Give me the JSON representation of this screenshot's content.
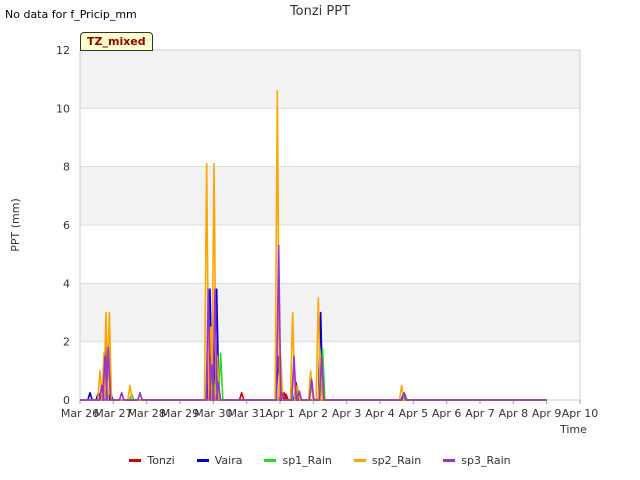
{
  "notice": "No data for f_Pricip_mm",
  "badge": "TZ_mixed",
  "colors": {
    "Tonzi": "#cc0000",
    "Vaira": "#0000cc",
    "sp1_Rain": "#22dd22",
    "sp2_Rain": "#ffa500",
    "sp3_Rain": "#9933cc"
  },
  "chart_data": {
    "type": "line",
    "title": "Tonzi PPT",
    "xlabel": "Time",
    "ylabel": "PPT (mm)",
    "ylim": [
      0,
      12
    ],
    "xlim": [
      "Mar 26",
      "Apr 10"
    ],
    "yticks": [
      0,
      2,
      4,
      6,
      8,
      10,
      12
    ],
    "xticks": [
      "Mar 26",
      "Mar 27",
      "Mar 28",
      "Mar 29",
      "Mar 30",
      "Mar 31",
      "Apr 1",
      "Apr 2",
      "Apr 3",
      "Apr 4",
      "Apr 5",
      "Apr 6",
      "Apr 7",
      "Apr 8",
      "Apr 9",
      "Apr 10"
    ],
    "grid": true,
    "legend_position": "bottom",
    "series": [
      {
        "name": "Tonzi",
        "points": [
          [
            0.65,
            0.25
          ],
          [
            4.85,
            0.25
          ],
          [
            6.12,
            0.25
          ],
          [
            6.18,
            0.2
          ]
        ]
      },
      {
        "name": "Vaira",
        "points": [
          [
            0.3,
            0.25
          ],
          [
            0.55,
            0.25
          ],
          [
            0.78,
            2.0
          ],
          [
            0.92,
            0.25
          ],
          [
            3.9,
            3.8
          ],
          [
            4.1,
            3.8
          ],
          [
            5.95,
            1.5
          ],
          [
            6.48,
            0.6
          ],
          [
            7.22,
            3.0
          ],
          [
            9.7,
            0.2
          ]
        ]
      },
      {
        "name": "sp1_Rain",
        "points": [
          [
            0.85,
            1.7
          ],
          [
            1.55,
            0.2
          ],
          [
            4.0,
            0.8
          ],
          [
            4.12,
            0.5
          ],
          [
            4.22,
            1.6
          ],
          [
            6.02,
            1.0
          ],
          [
            6.55,
            0.3
          ],
          [
            7.28,
            1.75
          ],
          [
            9.75,
            0.2
          ]
        ]
      },
      {
        "name": "sp2_Rain",
        "points": [
          [
            0.6,
            1.0
          ],
          [
            0.72,
            1.6
          ],
          [
            0.78,
            3.0
          ],
          [
            0.88,
            3.0
          ],
          [
            1.5,
            0.5
          ],
          [
            3.8,
            8.1
          ],
          [
            3.92,
            2.5
          ],
          [
            4.02,
            8.1
          ],
          [
            4.12,
            1.5
          ],
          [
            5.92,
            10.6
          ],
          [
            6.02,
            1.5
          ],
          [
            6.38,
            3.0
          ],
          [
            6.52,
            0.5
          ],
          [
            6.92,
            1.0
          ],
          [
            7.15,
            3.5
          ],
          [
            7.22,
            1.5
          ],
          [
            9.65,
            0.5
          ]
        ]
      },
      {
        "name": "sp3_Rain",
        "points": [
          [
            0.65,
            0.5
          ],
          [
            0.75,
            1.5
          ],
          [
            0.85,
            1.8
          ],
          [
            1.25,
            0.25
          ],
          [
            1.8,
            0.25
          ],
          [
            3.85,
            3.8
          ],
          [
            3.95,
            1.2
          ],
          [
            4.05,
            3.8
          ],
          [
            4.15,
            0.6
          ],
          [
            5.96,
            5.3
          ],
          [
            6.05,
            0.25
          ],
          [
            6.42,
            1.5
          ],
          [
            6.58,
            0.3
          ],
          [
            6.95,
            0.7
          ],
          [
            7.25,
            1.5
          ],
          [
            9.72,
            0.25
          ]
        ]
      }
    ]
  }
}
